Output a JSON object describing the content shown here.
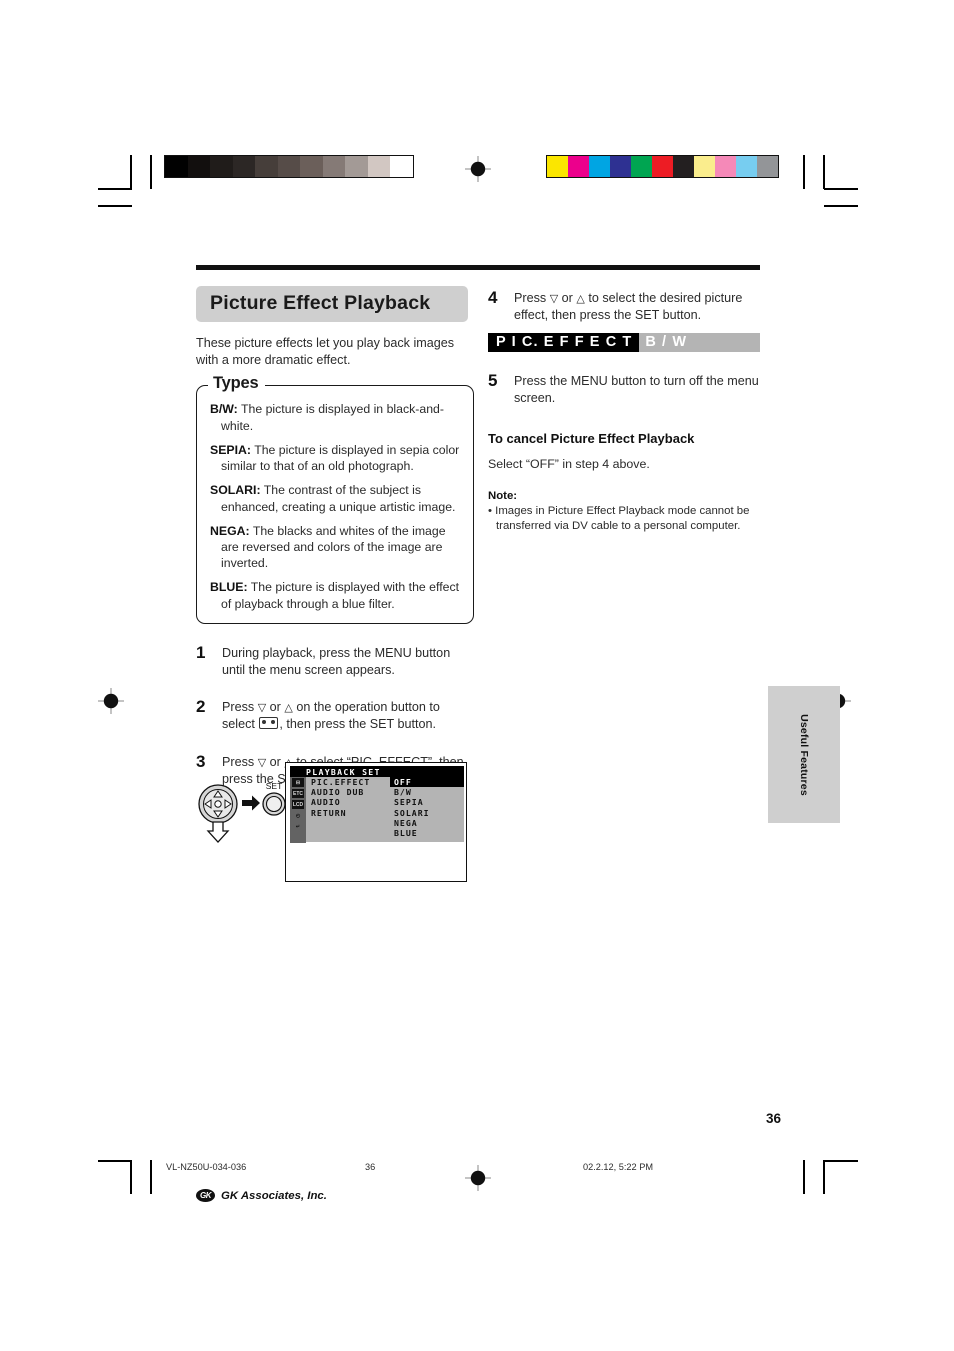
{
  "document": {
    "page_number": "36",
    "side_tab_label": "Useful Features"
  },
  "section": {
    "title": "Picture Effect Playback",
    "intro": "These picture effects let you play back images with a more dramatic effect."
  },
  "types_box": {
    "legend": "Types",
    "items": [
      {
        "term": "B/W:",
        "desc": " The picture is displayed in black-and-white."
      },
      {
        "term": "SEPIA:",
        "desc": " The picture is displayed in sepia color similar to that of an old photograph."
      },
      {
        "term": "SOLARI:",
        "desc": " The contrast of the subject is enhanced, creating a unique artistic image."
      },
      {
        "term": "NEGA:",
        "desc": " The blacks and whites of the image are reversed and colors of the image are inverted."
      },
      {
        "term": "BLUE:",
        "desc": " The picture is displayed with the effect of playback through a blue filter."
      }
    ]
  },
  "steps_left": [
    {
      "num": "1",
      "text": "During playback, press the MENU button until the menu screen appears."
    },
    {
      "num": "2",
      "text_a": "Press ",
      "gl1": "▽",
      "text_b": " or ",
      "gl2": "△",
      "text_c": " on the operation button to select ",
      "text_d": ", then press the SET button."
    },
    {
      "num": "3",
      "text_a": "Press ",
      "gl1": "▽",
      "text_b": " or ",
      "gl2": "△",
      "text_c": " to select “PIC. EFFECT”, then press the SET button."
    }
  ],
  "steps_right": [
    {
      "num": "4",
      "text_a": "Press ",
      "gl1": "▽",
      "text_b": " or ",
      "gl2": "△",
      "text_c": " to select the desired picture effect, then press the SET button."
    },
    {
      "num": "5",
      "text": "Press the MENU button to turn off the menu screen."
    }
  ],
  "status_bar": {
    "key": "P I C.  E F F E C T",
    "value": "B / W"
  },
  "cancel": {
    "heading": "To cancel Picture Effect Playback",
    "body": "Select “OFF” in step 4 above."
  },
  "note": {
    "heading": "Note:",
    "body": "• Images in Picture Effect Playback mode cannot be transferred via DV cable to a personal computer."
  },
  "op_button": {
    "set_label": "SET"
  },
  "menu_screen": {
    "title": "PLAYBACK SET",
    "icons": [
      "⊟",
      "ETC",
      "LCD",
      "◴",
      "↵"
    ],
    "items": [
      "PIC.EFFECT",
      "AUDIO DUB",
      "AUDIO",
      "RETURN"
    ],
    "values": [
      "OFF",
      "B/W",
      "SEPIA",
      "SOLARI",
      "NEGA",
      "BLUE"
    ],
    "selected_value": "OFF"
  },
  "calibration": {
    "grayscale": [
      "#010101",
      "#120f0e",
      "#201c1a",
      "#2c2725",
      "#463e3a",
      "#564c48",
      "#6b5f5a",
      "#857a76",
      "#a39a96",
      "#d2c7c2",
      "#ffffff"
    ],
    "colors": [
      "#fbe600",
      "#ec008c",
      "#00a5e3",
      "#2e3192",
      "#00a551",
      "#ed1c24",
      "#231f20",
      "#faed8d",
      "#f589b8",
      "#77cdf0",
      "#939598"
    ]
  },
  "footer": {
    "file_id": "VL-NZ50U-034-036",
    "page": "36",
    "timestamp": "02.2.12, 5:22 PM",
    "company_mark": "GK",
    "company_name": "GK Associates, Inc."
  }
}
